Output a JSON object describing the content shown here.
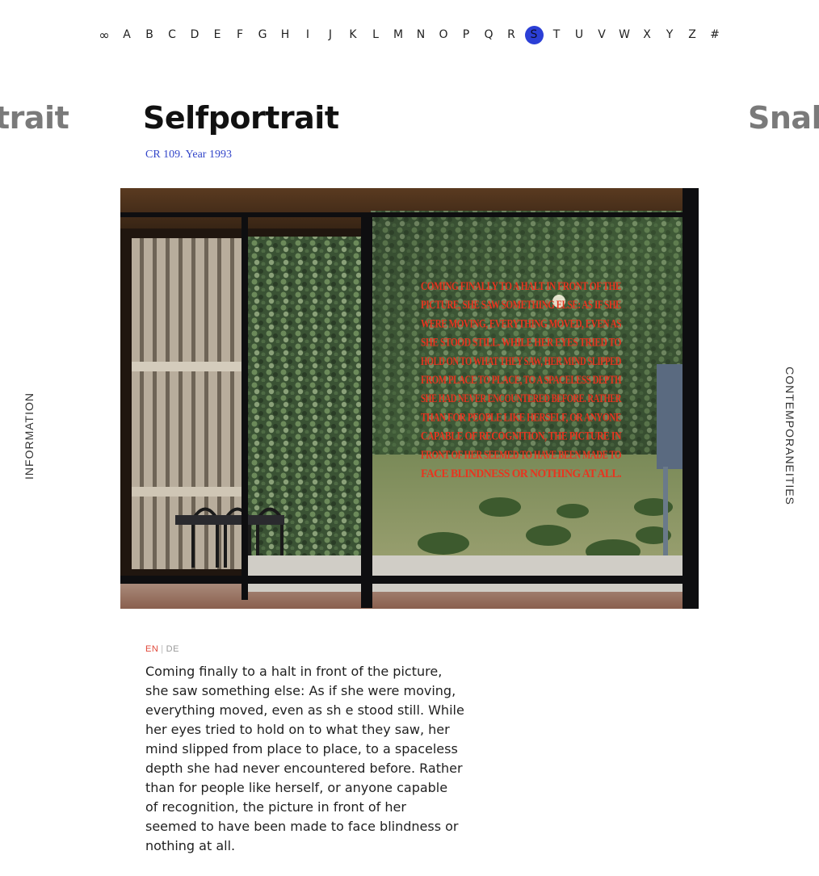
{
  "alphabet_nav": {
    "items": [
      "∞",
      "A",
      "B",
      "C",
      "D",
      "E",
      "F",
      "G",
      "H",
      "I",
      "J",
      "K",
      "L",
      "M",
      "N",
      "O",
      "P",
      "Q",
      "R",
      "S",
      "T",
      "U",
      "V",
      "W",
      "X",
      "Y",
      "Z",
      "#"
    ],
    "active": "S",
    "active_color": "#2b3fd6"
  },
  "titles": {
    "previous": "trait",
    "current": "Selfportrait",
    "next": "Snak"
  },
  "subtitle": "CR 109. Year 1993",
  "side_tabs": {
    "left": "INFORMATION",
    "right": "CONTEMPORANEITIES"
  },
  "artwork": {
    "description_icon": "photo-window-ivy-installation",
    "window_text_lines": [
      "COMING FINALLY TO A HALT IN FRONT OF THE",
      "PICTURE, SHE SAW SOMETHING ELSE: AS IF SHE",
      "WERE MOVING, EVERYTHING MOVED, EVEN AS",
      "SHE STOOD STILL. WHILE HER EYES TRIED TO",
      "HOLD ON TO WHAT THEY SAW, HER MIND SLIPPED",
      "FROM PLACE TO PLACE, TO A SPACELESS DEPTH",
      "SHE HAD NEVER ENCOUNTERED BEFORE. RATHER",
      "THAN FOR PEOPLE LIKE HERSELF, OR ANYONE",
      "CAPABLE OF RECOGNITION, THE PICTURE IN",
      "FRONT OF HER SEEMED TO HAVE BEEN MADE TO",
      "FACE BLINDNESS OR NOTHING AT ALL."
    ],
    "window_text_color": "#e8341f"
  },
  "language": {
    "en": "EN",
    "separator": "|",
    "de": "DE",
    "active": "EN",
    "active_color": "#e0483a"
  },
  "body_lines": [
    "Coming finally to a halt in front of the picture,",
    "she saw something else: As if she were moving,",
    "everything moved, even as sh e stood still. While",
    "her eyes tried to hold on to what they saw, her",
    "mind slipped from place to place, to a spaceless",
    "depth she had never encountered before. Rather",
    "than for people like herself, or anyone capable",
    "of recognition, the picture in front of her",
    "seemed to have been made to face blindness or",
    "nothing at all."
  ]
}
